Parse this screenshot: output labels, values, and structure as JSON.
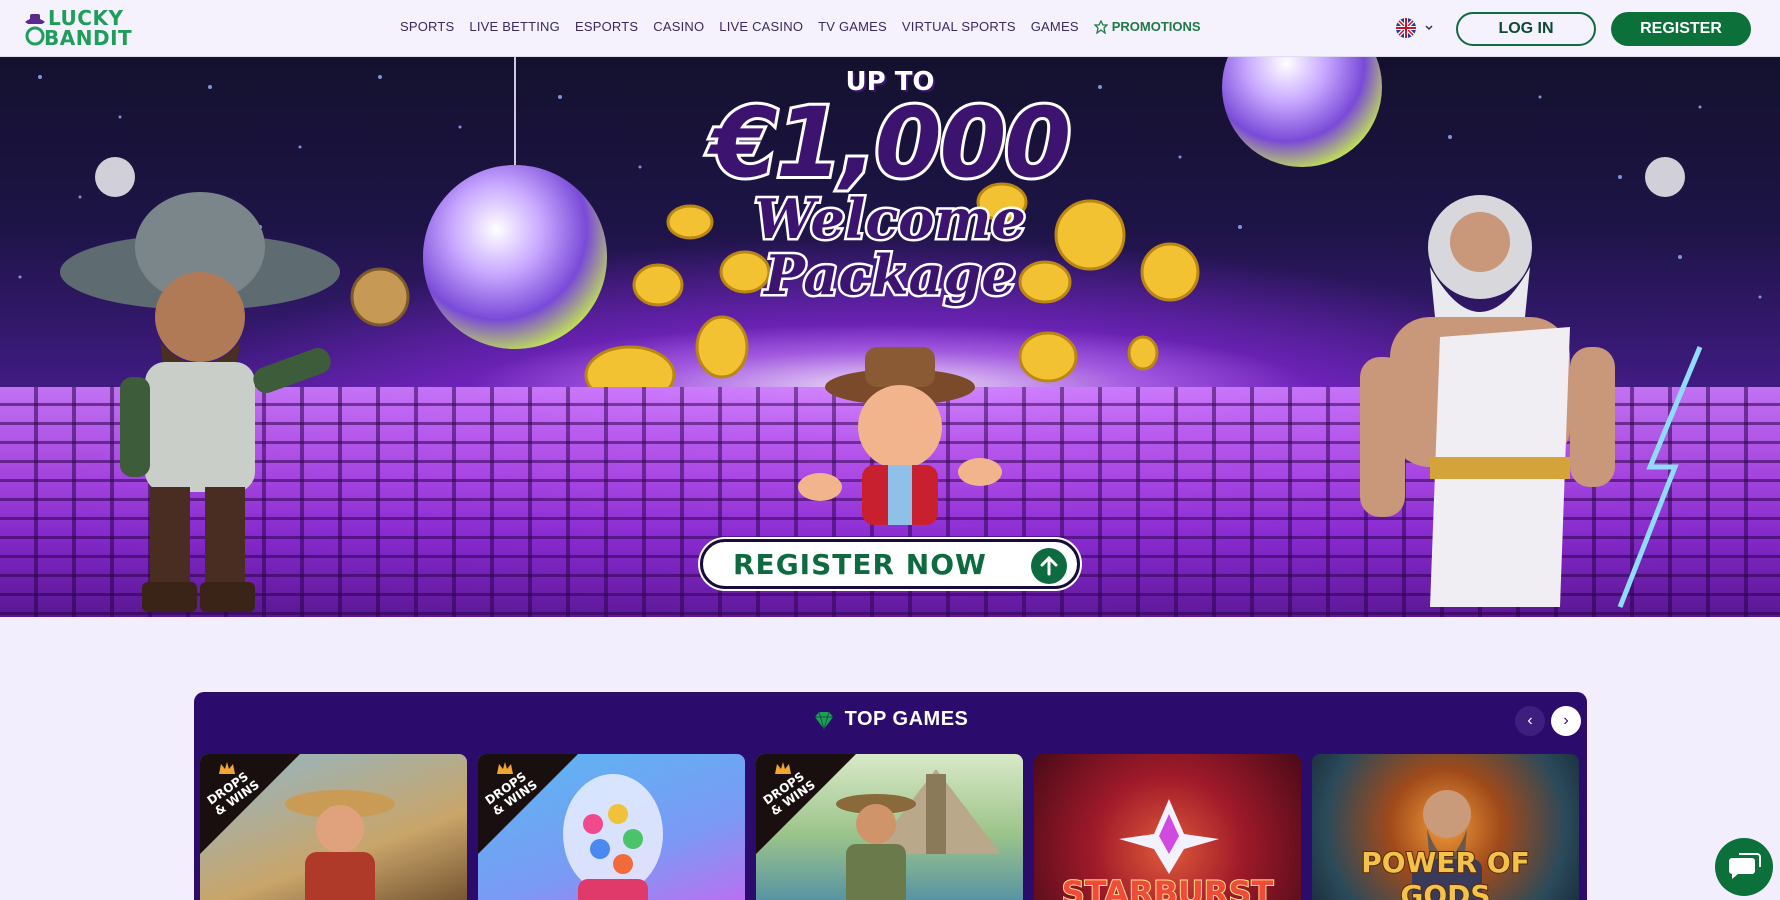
{
  "brand": {
    "line1": "LUCKY",
    "line2": "BANDIT"
  },
  "nav": {
    "items": [
      "SPORTS",
      "LIVE BETTING",
      "ESPORTS",
      "CASINO",
      "LIVE CASINO",
      "TV GAMES",
      "VIRTUAL SPORTS",
      "GAMES"
    ],
    "promotions": "PROMOTIONS"
  },
  "header": {
    "login": "LOG IN",
    "register": "REGISTER"
  },
  "hero": {
    "upto": "UP TO",
    "amount": "€1,000",
    "welcome1": "Welcome",
    "welcome2": "Package",
    "cta": "REGISTER NOW"
  },
  "top_games": {
    "title": "TOP GAMES",
    "cards": [
      {
        "badge": "DROPS & WINS",
        "title": ""
      },
      {
        "badge": "DROPS & WINS",
        "title": ""
      },
      {
        "badge": "DROPS & WINS",
        "title": ""
      },
      {
        "badge": "",
        "title": "STARBURST"
      },
      {
        "badge": "",
        "title": "POWER OF GODS"
      }
    ]
  },
  "colors": {
    "brand_green": "#0b7039",
    "purple_dark": "#2b0b6b",
    "page_bg": "#f3eefd"
  },
  "icons": [
    "cowboy-hat-logo",
    "promotion-icon",
    "uk-flag-icon",
    "chevron-down-icon",
    "arrow-up-icon",
    "gem-icon",
    "chevron-left-icon",
    "chevron-right-icon",
    "chat-icon"
  ]
}
